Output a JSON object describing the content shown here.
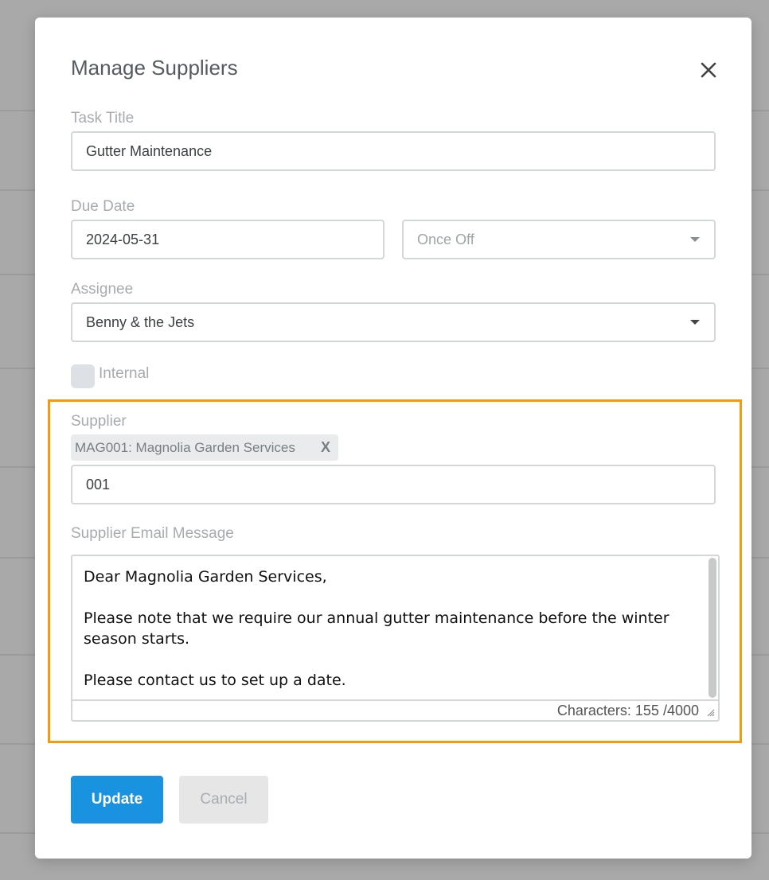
{
  "modal": {
    "title": "Manage Suppliers",
    "close_icon": "close-icon"
  },
  "task_title": {
    "label": "Task Title",
    "value": "Gutter Maintenance"
  },
  "due_date": {
    "label": "Due Date",
    "value": "2024-05-31",
    "frequency": "Once Off"
  },
  "assignee": {
    "label": "Assignee",
    "value": "Benny & the Jets"
  },
  "internal": {
    "label": "Internal",
    "checked": false
  },
  "supplier": {
    "label": "Supplier",
    "selected_chip": "MAG001: Magnolia Garden Services",
    "chip_remove": "X",
    "search_value": "001"
  },
  "email_message": {
    "label": "Supplier Email Message",
    "body": "Dear Magnolia Garden Services,\n\nPlease note that we require our annual gutter maintenance before the winter season starts.\n\nPlease contact us to set up a date.",
    "char_count": "Characters: 155 /4000"
  },
  "buttons": {
    "update": "Update",
    "cancel": "Cancel"
  },
  "colors": {
    "primary": "#1993e0",
    "highlight": "#f59a0c"
  }
}
